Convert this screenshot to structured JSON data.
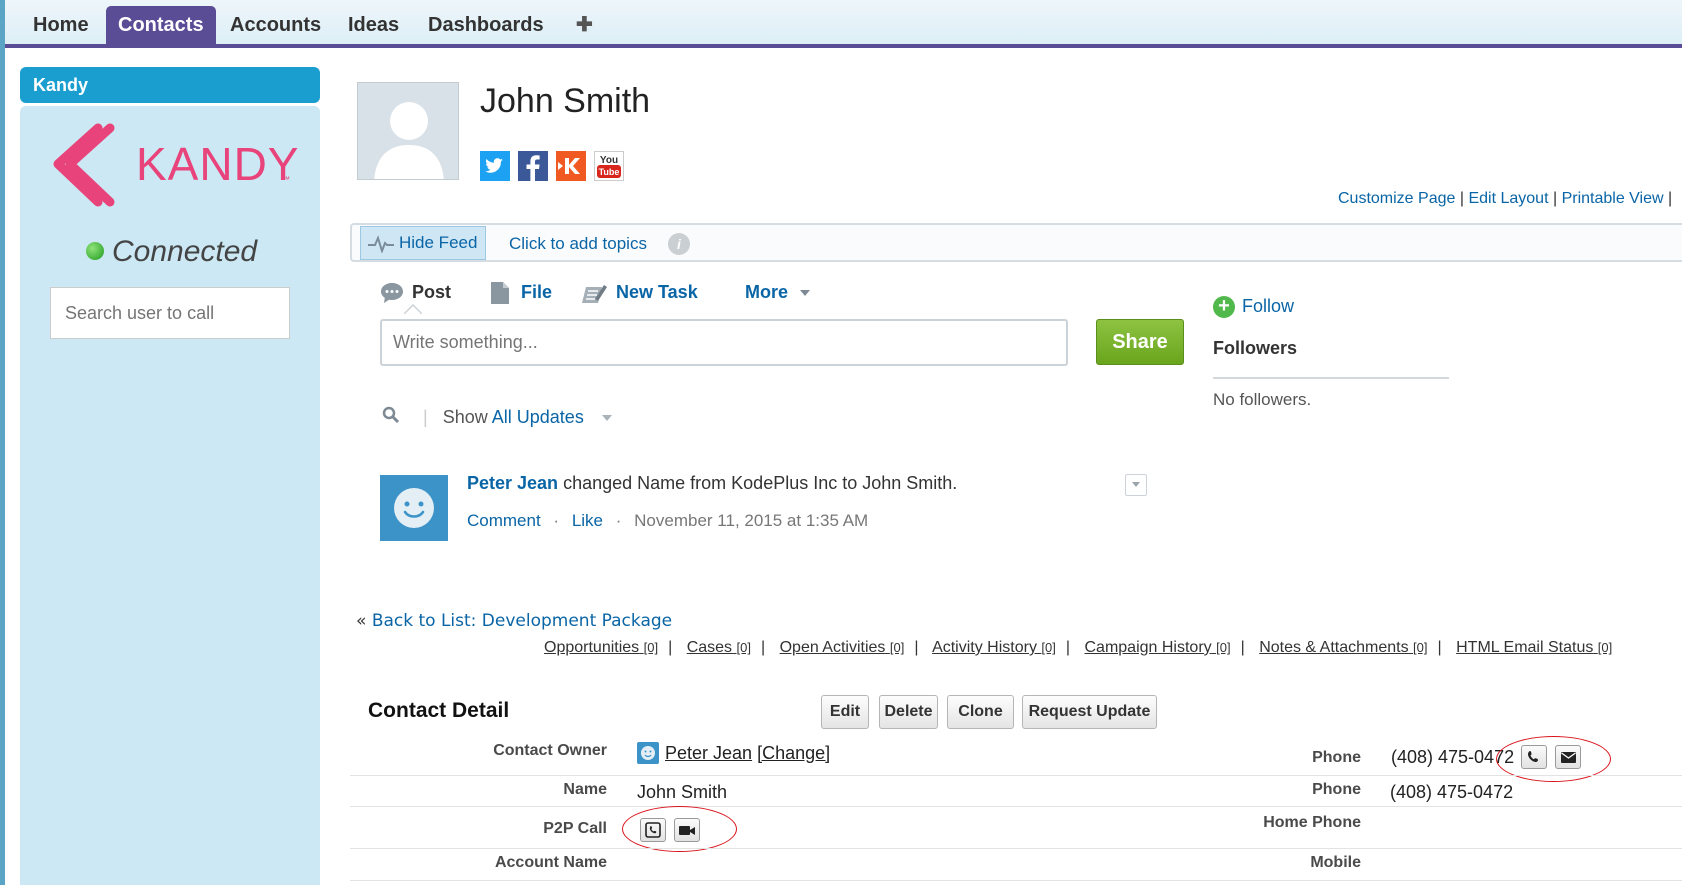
{
  "tabs": [
    {
      "label": "Home",
      "active": false
    },
    {
      "label": "Contacts",
      "active": true
    },
    {
      "label": "Accounts",
      "active": false
    },
    {
      "label": "Ideas",
      "active": false
    },
    {
      "label": "Dashboards",
      "active": false
    },
    {
      "label": "✚",
      "active": false
    }
  ],
  "sidebar": {
    "title": "Kandy",
    "logo_text": "KANDY",
    "logo_tm": "™",
    "status": "Connected",
    "search_placeholder": "Search user to call"
  },
  "contact": {
    "name": "John Smith",
    "social": [
      "twitter-icon",
      "facebook-icon",
      "klout-icon",
      "youtube-icon"
    ],
    "youtube_top": "You",
    "youtube_bottom": "Tube"
  },
  "page_links": {
    "customize": "Customize Page",
    "edit_layout": "Edit Layout",
    "printable": "Printable View",
    "separator": "|"
  },
  "feed_bar": {
    "hide_feed": "Hide Feed",
    "topics": "Click to add topics",
    "info": "i"
  },
  "publisher": {
    "post": "Post",
    "file": "File",
    "new_task": "New Task",
    "more": "More",
    "placeholder": "Write something...",
    "share": "Share"
  },
  "filter": {
    "show": "Show",
    "value": "All Updates"
  },
  "follow": {
    "follow_label": "Follow",
    "followers_title": "Followers",
    "no_followers": "No followers."
  },
  "feed_item": {
    "actor": "Peter Jean",
    "text": "changed Name from KodePlus Inc to John Smith.",
    "comment": "Comment",
    "like": "Like",
    "dot": "·",
    "timestamp": "November 11, 2015 at 1:35 AM"
  },
  "back_list": {
    "prefix": "«",
    "label": "Back to List: Development Package"
  },
  "related_lists": [
    {
      "label": "Opportunities",
      "count": "[0]"
    },
    {
      "label": "Cases",
      "count": "[0]"
    },
    {
      "label": "Open Activities",
      "count": "[0]"
    },
    {
      "label": "Activity History",
      "count": "[0]"
    },
    {
      "label": "Campaign History",
      "count": "[0]"
    },
    {
      "label": "Notes & Attachments",
      "count": "[0]"
    },
    {
      "label": "HTML Email Status",
      "count": "[0]"
    }
  ],
  "detail": {
    "title": "Contact Detail",
    "buttons": {
      "edit": "Edit",
      "delete": "Delete",
      "clone": "Clone",
      "request_update": "Request Update"
    },
    "owner_label": "Contact Owner",
    "owner_value": "Peter Jean",
    "owner_change": "[Change]",
    "name_label": "Name",
    "name_value": "John Smith",
    "p2p_label": "P2P Call",
    "account_label": "Account Name",
    "phone_label": "Phone",
    "phone_value": "(408) 475-0472",
    "phone2_label": "Phone",
    "phone2_value": "(408) 475-0472",
    "home_phone_label": "Home Phone",
    "mobile_label": "Mobile"
  },
  "colors": {
    "accent": "#5b4c96",
    "link": "#0a65a6",
    "kandy_blue": "#1a9ecf",
    "kandy_pink": "#e8437a",
    "share_green": "#7ab52e",
    "highlight_red": "#d9141b"
  }
}
